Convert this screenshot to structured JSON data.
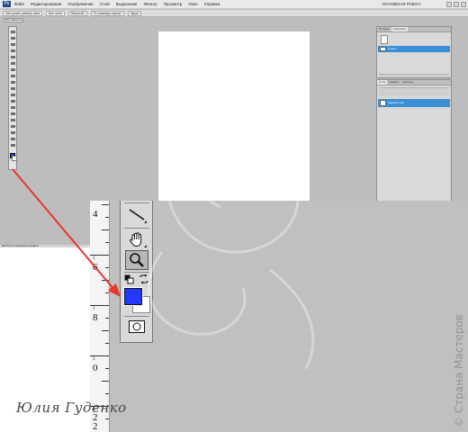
{
  "photoshop": {
    "logo": "Ps",
    "menu": [
      "Файл",
      "Редактирование",
      "Изображение",
      "Слой",
      "Выделение",
      "Фильтр",
      "Просмотр",
      "Окно",
      "Справка"
    ],
    "workspace_label": "ОСНОВНАЯ РАБОЧ.",
    "options_bar": [
      "Настроить размер окна",
      "Все окна",
      "Масштаб",
      "По размеру экрана",
      "Экран"
    ],
    "document_tab": "Без имени-1 @ 66,7%",
    "status_text": "66,67% Не сохраненный профиль",
    "panel_history": {
      "tabs": [
        "История",
        "Операции"
      ],
      "selected_item": "Новый"
    },
    "panel_layers": {
      "tabs": [
        "Слои",
        "Каналы",
        "Контуры"
      ],
      "selected_layer": "Задний план"
    }
  },
  "inset": {
    "ruler_numbers": [
      "4",
      "6",
      "8",
      "0",
      "2",
      "2"
    ],
    "ruler_subs": [
      "1",
      "1",
      "2",
      "2"
    ],
    "foreground_color": "#2438ff",
    "background_color": "#ffffff"
  },
  "annotations": {
    "arrow_color": "#e8342c",
    "signature": "Юлия Гуденко",
    "watermark": "© Страна Мастеров"
  },
  "icons": [
    "line-tool-icon",
    "hand-tool-icon",
    "zoom-tool-icon",
    "default-colors-icon",
    "swap-colors-icon",
    "quick-mask-icon"
  ]
}
